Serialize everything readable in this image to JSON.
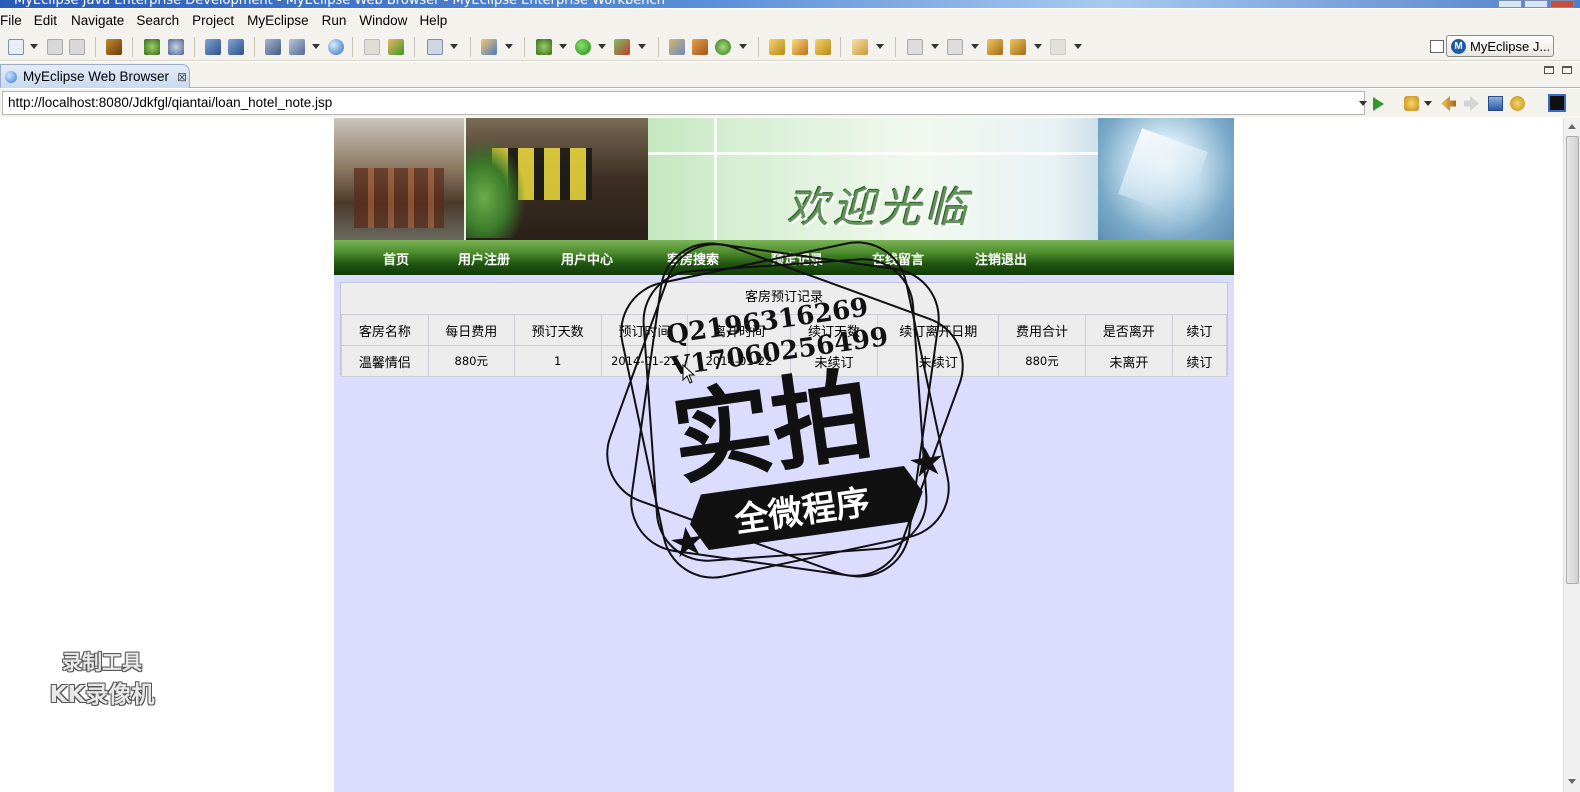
{
  "window": {
    "title": "MyEclipse Java Enterprise Development - MyEclipse Web Browser - MyEclipse Enterprise Workbench"
  },
  "menu": [
    "File",
    "Edit",
    "Navigate",
    "Search",
    "Project",
    "MyEclipse",
    "Run",
    "Window",
    "Help"
  ],
  "toolbar": {
    "perspective_label": "MyEclipse J..."
  },
  "editor": {
    "tab_label": "MyEclipse Web Browser",
    "tab_close": "⊠"
  },
  "browser": {
    "url": "http://localhost:8080/Jdkfgl/qiantai/loan_hotel_note.jsp"
  },
  "site": {
    "banner_text": "欢迎光临",
    "nav": [
      "首页",
      "用户注册",
      "用户中心",
      "客房搜索",
      "预定记录",
      "在线留言",
      "注销退出"
    ],
    "table_caption": "客房预订记录",
    "table_headers": [
      "客房名称",
      "每日费用",
      "预订天数",
      "预订时间",
      "离开时间",
      "续订天数",
      "续订离开日期",
      "费用合计",
      "是否离开",
      "续订"
    ],
    "table_rows": [
      [
        "温馨情侣",
        "880元",
        "1",
        "2014-01-21",
        "2014-01-22",
        "未续订",
        "未续订",
        "880元",
        "未离开",
        "续订"
      ]
    ]
  },
  "overlay": {
    "stamp_line1": "Q2196316269",
    "stamp_line2": "V17060256499",
    "stamp_main": "实拍",
    "stamp_ribbon": "全微程序",
    "recorder_line1": "录制工具",
    "recorder_line2": "KK录像机"
  },
  "colors": {
    "page_bg": "#dcdcff",
    "nav_green": "#2e6a1a",
    "chrome_bg": "#f4f2ed"
  }
}
